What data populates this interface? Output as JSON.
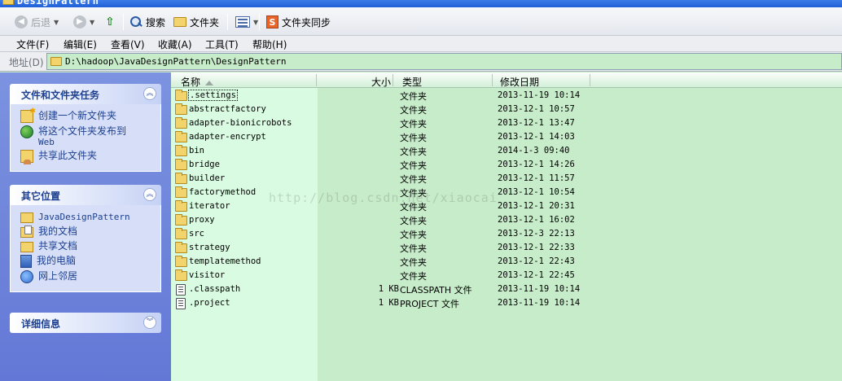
{
  "window": {
    "title": "DesignPattern"
  },
  "toolbar": {
    "back_label": "后退",
    "search_label": "搜索",
    "folders_label": "文件夹",
    "sync_label": "文件夹同步"
  },
  "menu": {
    "items": [
      "文件(F)",
      "编辑(E)",
      "查看(V)",
      "收藏(A)",
      "工具(T)",
      "帮助(H)"
    ]
  },
  "address": {
    "label": "地址(D)",
    "path": "D:\\hadoop\\JavaDesignPattern\\DesignPattern"
  },
  "taskpane": {
    "file_tasks": {
      "title": "文件和文件夹任务",
      "items": [
        {
          "label": "创建一个新文件夹",
          "icon": "new-folder-icon"
        },
        {
          "label": "将这个文件夹发布到",
          "label2": "Web",
          "icon": "web-publish-icon"
        },
        {
          "label": "共享此文件夹",
          "icon": "share-folder-icon"
        }
      ]
    },
    "other_places": {
      "title": "其它位置",
      "items": [
        {
          "label": "JavaDesignPattern",
          "icon": "folder-icon"
        },
        {
          "label": "我的文档",
          "icon": "my-documents-icon"
        },
        {
          "label": "共享文档",
          "icon": "shared-documents-icon"
        },
        {
          "label": "我的电脑",
          "icon": "my-computer-icon"
        },
        {
          "label": "网上邻居",
          "icon": "network-places-icon"
        }
      ]
    },
    "details": {
      "title": "详细信息"
    }
  },
  "list": {
    "columns": {
      "name": "名称",
      "size": "大小",
      "type": "类型",
      "date": "修改日期"
    },
    "rows": [
      {
        "name": ".settings",
        "size": "",
        "type": "文件夹",
        "date": "2013-11-19 10:14",
        "kind": "folder"
      },
      {
        "name": "abstractfactory",
        "size": "",
        "type": "文件夹",
        "date": "2013-12-1 10:57",
        "kind": "folder"
      },
      {
        "name": "adapter-bionicrobots",
        "size": "",
        "type": "文件夹",
        "date": "2013-12-1 13:47",
        "kind": "folder"
      },
      {
        "name": "adapter-encrypt",
        "size": "",
        "type": "文件夹",
        "date": "2013-12-1 14:03",
        "kind": "folder"
      },
      {
        "name": "bin",
        "size": "",
        "type": "文件夹",
        "date": "2014-1-3 09:40",
        "kind": "folder"
      },
      {
        "name": "bridge",
        "size": "",
        "type": "文件夹",
        "date": "2013-12-1 14:26",
        "kind": "folder"
      },
      {
        "name": "builder",
        "size": "",
        "type": "文件夹",
        "date": "2013-12-1 11:57",
        "kind": "folder"
      },
      {
        "name": "factorymethod",
        "size": "",
        "type": "文件夹",
        "date": "2013-12-1 10:54",
        "kind": "folder"
      },
      {
        "name": "iterator",
        "size": "",
        "type": "文件夹",
        "date": "2013-12-1 20:31",
        "kind": "folder"
      },
      {
        "name": "proxy",
        "size": "",
        "type": "文件夹",
        "date": "2013-12-1 16:02",
        "kind": "folder"
      },
      {
        "name": "src",
        "size": "",
        "type": "文件夹",
        "date": "2013-12-3 22:13",
        "kind": "folder"
      },
      {
        "name": "strategy",
        "size": "",
        "type": "文件夹",
        "date": "2013-12-1 22:33",
        "kind": "folder"
      },
      {
        "name": "templatemethod",
        "size": "",
        "type": "文件夹",
        "date": "2013-12-1 22:43",
        "kind": "folder"
      },
      {
        "name": "visitor",
        "size": "",
        "type": "文件夹",
        "date": "2013-12-1 22:45",
        "kind": "folder"
      },
      {
        "name": ".classpath",
        "size": "1 KB",
        "type": "CLASSPATH 文件",
        "date": "2013-11-19 10:14",
        "kind": "file"
      },
      {
        "name": ".project",
        "size": "1 KB",
        "type": "PROJECT 文件",
        "date": "2013-11-19 10:14",
        "kind": "file"
      }
    ]
  },
  "watermark": "http://blog.csdn.net/xiaocai"
}
